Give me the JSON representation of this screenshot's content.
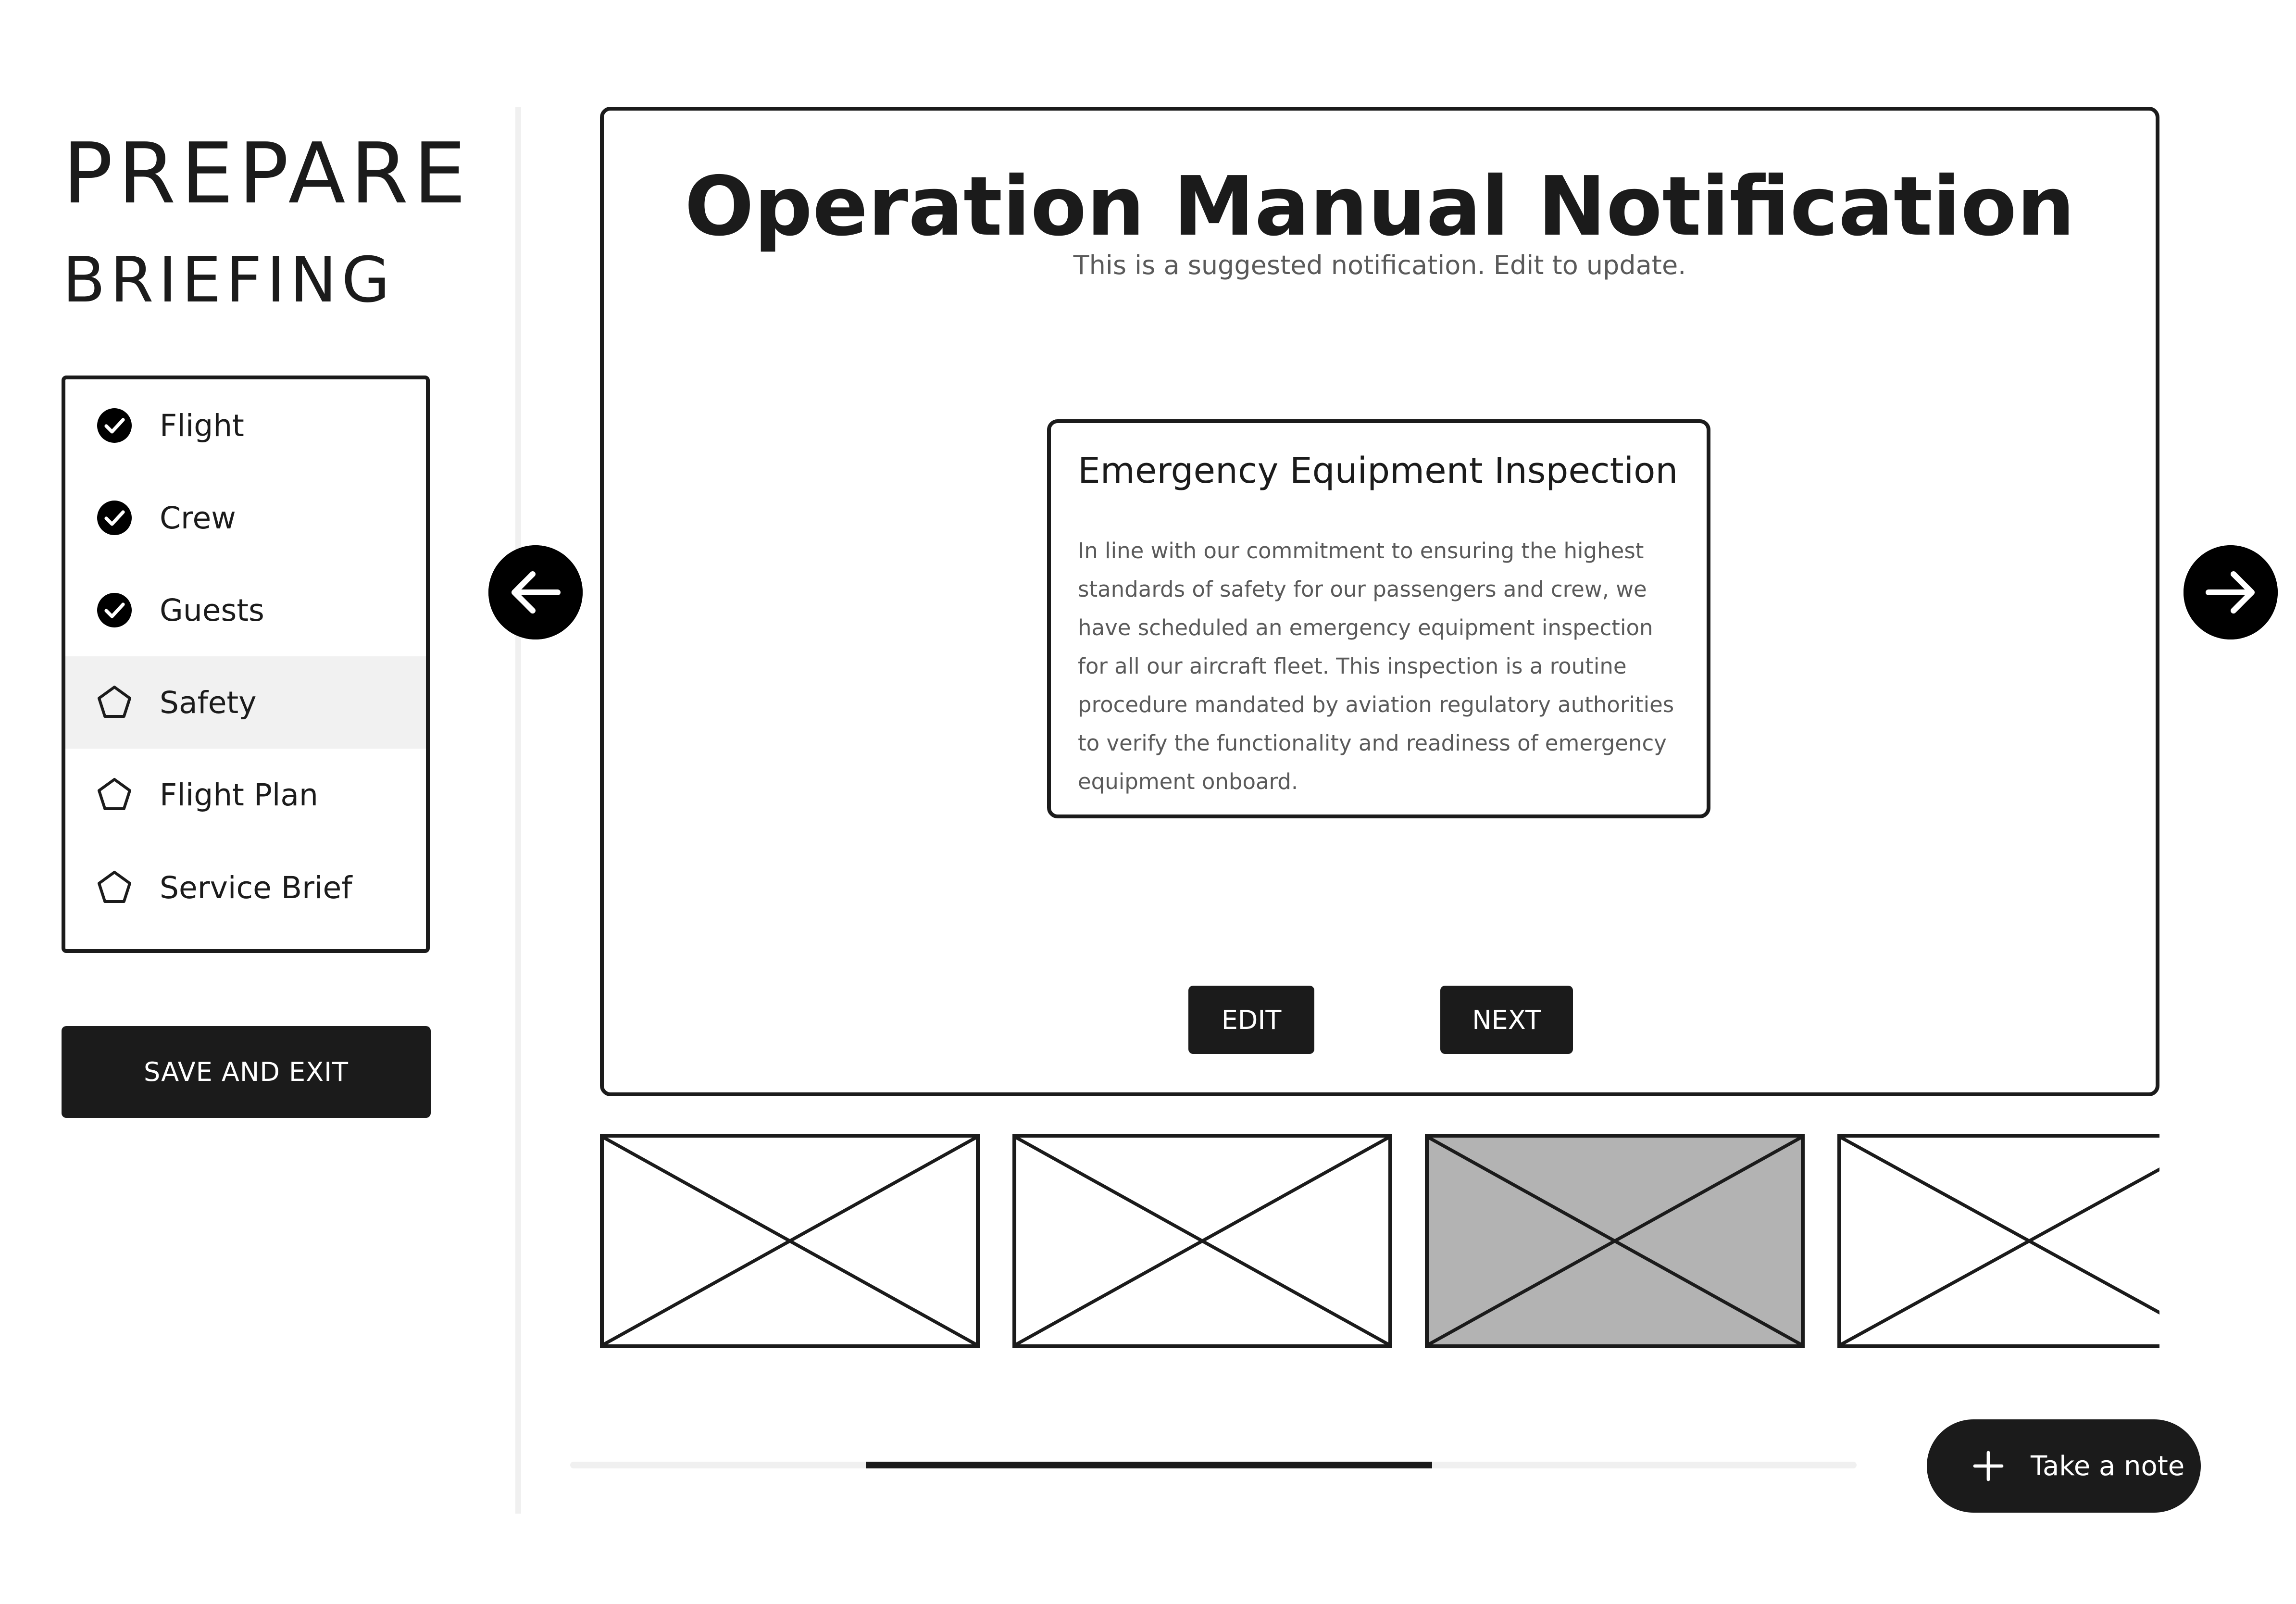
{
  "sidebar": {
    "title_line1": "PREPARE",
    "title_line2": "BRIEFING",
    "items": [
      {
        "label": "Flight",
        "status": "complete",
        "icon": "check-circle-icon"
      },
      {
        "label": "Crew",
        "status": "complete",
        "icon": "check-circle-icon"
      },
      {
        "label": "Guests",
        "status": "complete",
        "icon": "check-circle-icon"
      },
      {
        "label": "Safety",
        "status": "current",
        "icon": "pentagon-icon"
      },
      {
        "label": "Flight Plan",
        "status": "pending",
        "icon": "pentagon-icon"
      },
      {
        "label": "Service Brief",
        "status": "pending",
        "icon": "pentagon-icon"
      }
    ],
    "save_exit_label": "SAVE AND EXIT"
  },
  "main": {
    "title": "Operation Manual Notification",
    "subtitle": "This is a suggested notification. Edit to update.",
    "card": {
      "title": "Emergency Equipment Inspection",
      "body": "In line with our commitment to ensuring the highest standards of safety for our passengers and crew, we have scheduled an emergency equipment inspection for all our aircraft fleet. This inspection is a routine procedure mandated by aviation regulatory authorities to verify the functionality and readiness of emergency equipment onboard."
    },
    "edit_label": "EDIT",
    "next_label": "NEXT"
  },
  "navigation": {
    "prev_icon": "arrow-left-icon",
    "next_icon": "arrow-right-icon"
  },
  "thumbnails": {
    "count_visible": 4,
    "selected_index": 2
  },
  "progress": {
    "start_fraction": 0.23,
    "end_fraction": 0.67
  },
  "take_note": {
    "label": "Take a note",
    "icon": "plus-icon"
  },
  "colors": {
    "ink": "#1b1b1b",
    "muted_text": "#5a5a5a",
    "active_item_bg": "#f1f1f1",
    "selected_thumb_bg": "#b3b3b3",
    "track": "#f0f0f0"
  }
}
